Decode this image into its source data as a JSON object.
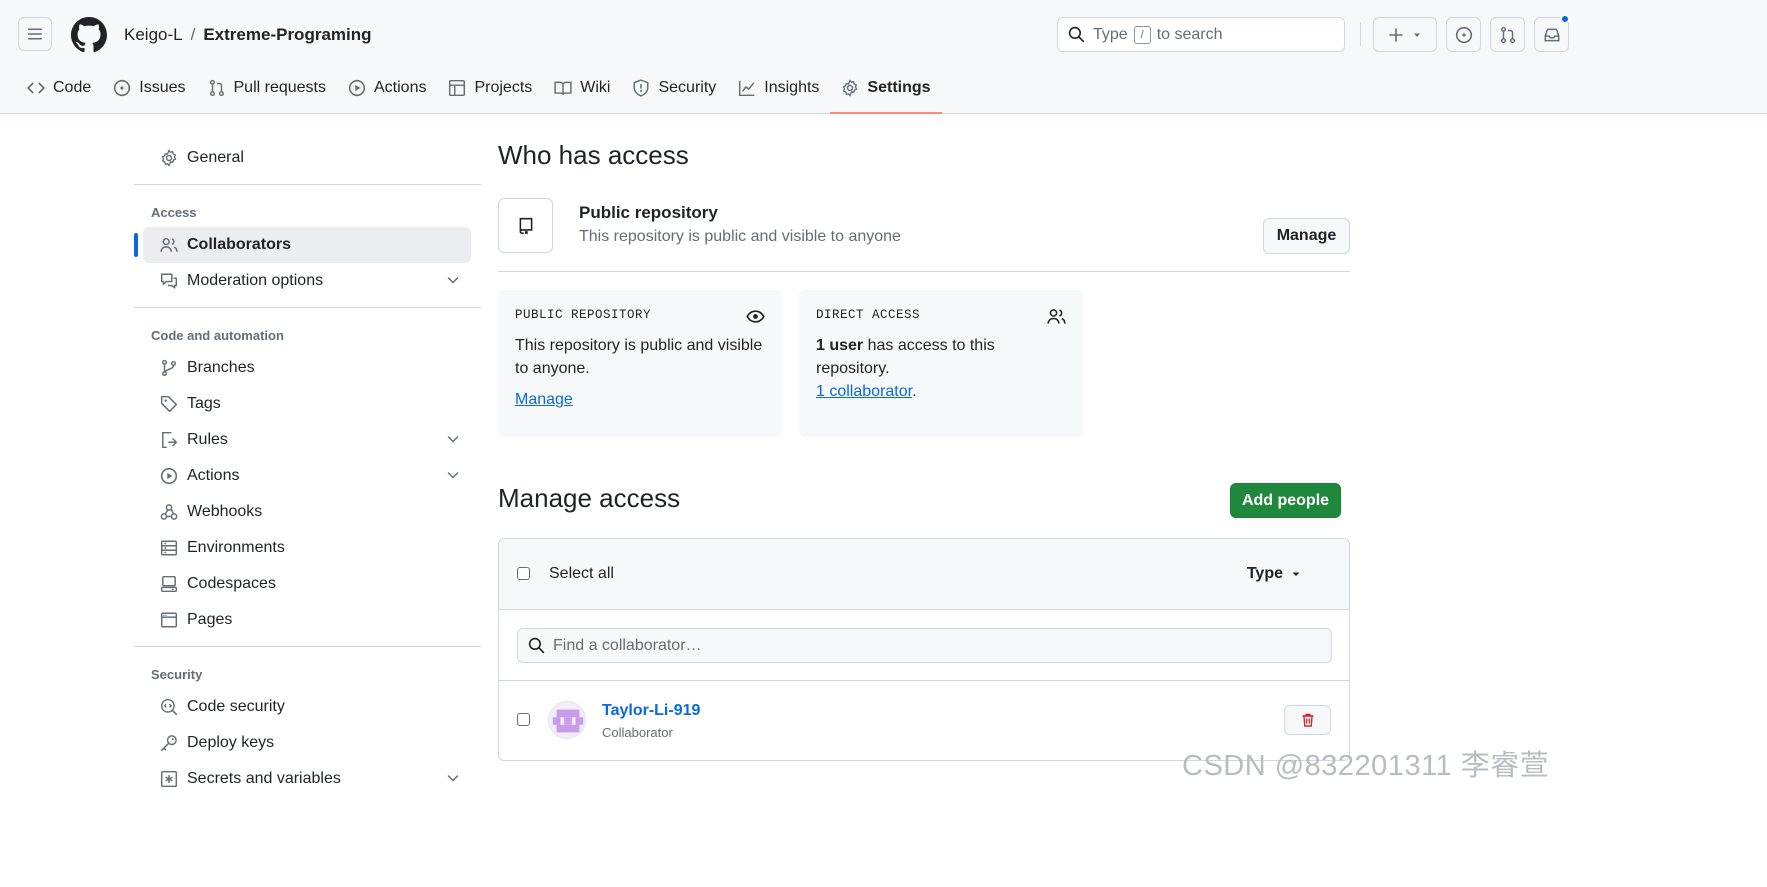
{
  "header": {
    "owner": "Keigo-L",
    "separator": "/",
    "repo": "Extreme-Programing",
    "search": {
      "prefix": "Type",
      "key": "/",
      "suffix": "to search"
    }
  },
  "tabs": [
    {
      "label": "Code",
      "icon": "code-icon"
    },
    {
      "label": "Issues",
      "icon": "issue-icon"
    },
    {
      "label": "Pull requests",
      "icon": "pull-request-icon"
    },
    {
      "label": "Actions",
      "icon": "play-icon"
    },
    {
      "label": "Projects",
      "icon": "table-icon"
    },
    {
      "label": "Wiki",
      "icon": "book-icon"
    },
    {
      "label": "Security",
      "icon": "shield-icon"
    },
    {
      "label": "Insights",
      "icon": "graph-icon"
    },
    {
      "label": "Settings",
      "icon": "gear-icon",
      "active": true
    }
  ],
  "sidebar": {
    "general": "General",
    "access_heading": "Access",
    "collaborators": "Collaborators",
    "moderation": "Moderation options",
    "code_heading": "Code and automation",
    "code_items": [
      "Branches",
      "Tags",
      "Rules",
      "Actions",
      "Webhooks",
      "Environments",
      "Codespaces",
      "Pages"
    ],
    "security_heading": "Security",
    "security_items": [
      "Code security",
      "Deploy keys",
      "Secrets and variables"
    ]
  },
  "main": {
    "title": "Who has access",
    "public_title": "Public repository",
    "public_sub": "This repository is public and visible to anyone",
    "manage_label": "Manage",
    "card_public": {
      "label": "PUBLIC REPOSITORY",
      "text": "This repository is public and visible to anyone.",
      "link": "Manage"
    },
    "card_direct": {
      "label": "DIRECT ACCESS",
      "count": "1 user",
      "text": " has access to this repository.",
      "link": "1 collaborator",
      "period": "."
    },
    "manage_access_title": "Manage access",
    "add_people": "Add people",
    "select_all": "Select all",
    "type_filter": "Type",
    "find_placeholder": "Find a collaborator…",
    "collaborator": {
      "name": "Taylor-Li-919",
      "role": "Collaborator"
    }
  },
  "watermark": "CSDN @832201311 李睿萱",
  "colors": {
    "accent": "#0969da",
    "primary_button": "#1f883d",
    "active_tab_underline": "#fd8c73",
    "danger": "#cf222e"
  }
}
